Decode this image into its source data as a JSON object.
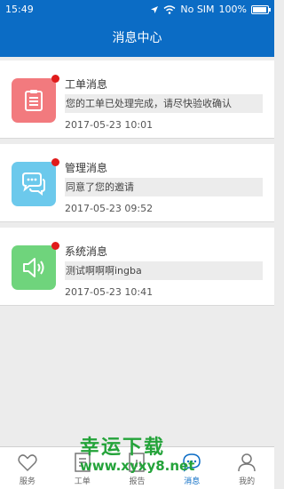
{
  "status_bar": {
    "time": "15:49",
    "carrier": "No SIM",
    "battery": "100%"
  },
  "header": {
    "title": "消息中心"
  },
  "messages": [
    {
      "category": "工单消息",
      "content": "您的工单已处理完成，请尽快验收确认",
      "time": "2017-05-23 10:01",
      "icon": "clipboard-icon",
      "color": "#f27a7e"
    },
    {
      "category": "管理消息",
      "content": "同意了您的邀请",
      "time": "2017-05-23 09:52",
      "icon": "chat-bubbles-icon",
      "color": "#6cc9ec"
    },
    {
      "category": "系统消息",
      "content": "测试啊啊啊ingba",
      "time": "2017-05-23 10:41",
      "icon": "speaker-icon",
      "color": "#6fd47c"
    }
  ],
  "tabs": [
    {
      "label": "服务",
      "icon": "heart-icon",
      "active": false
    },
    {
      "label": "工单",
      "icon": "document-icon",
      "active": false
    },
    {
      "label": "报告",
      "icon": "report-icon",
      "active": false
    },
    {
      "label": "消息",
      "icon": "chat-icon",
      "active": true
    },
    {
      "label": "我的",
      "icon": "person-icon",
      "active": false
    }
  ],
  "accent_color": "#0b6cc5",
  "watermark": {
    "text": "幸运下载",
    "url": "www.xyxy8.net"
  }
}
